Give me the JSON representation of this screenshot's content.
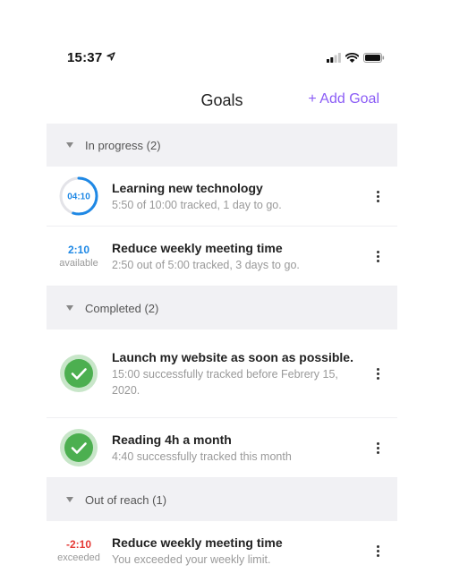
{
  "status_bar": {
    "time": "15:37"
  },
  "header": {
    "title": "Goals",
    "add_goal_label": "+ Add Goal"
  },
  "colors": {
    "accent": "#8b5cf6",
    "progress": "#1e88e5",
    "success": "#4caf50",
    "danger": "#e53935"
  },
  "sections": [
    {
      "label": "In progress (2)",
      "goals": [
        {
          "kind": "progress",
          "ring_label": "04:10",
          "progress": 0.55,
          "title": "Learning new technology",
          "subtitle": "5:50 of 10:00 tracked, 1 day to go."
        },
        {
          "kind": "available",
          "value": "2:10",
          "value_label": "available",
          "title": "Reduce weekly meeting time",
          "subtitle": "2:50 out of 5:00 tracked, 3 days to go."
        }
      ]
    },
    {
      "label": "Completed (2)",
      "goals": [
        {
          "kind": "completed",
          "title": "Launch my website as soon as possible.",
          "subtitle": "15:00 successfully tracked before Febrery 15, 2020."
        },
        {
          "kind": "completed",
          "title": "Reading 4h a month",
          "subtitle": "4:40 successfully tracked this month"
        }
      ]
    },
    {
      "label": "Out of reach (1)",
      "goals": [
        {
          "kind": "exceeded",
          "value": "-2:10",
          "value_label": "exceeded",
          "title": "Reduce weekly meeting time",
          "subtitle": "You exceeded your weekly limit."
        }
      ]
    }
  ]
}
